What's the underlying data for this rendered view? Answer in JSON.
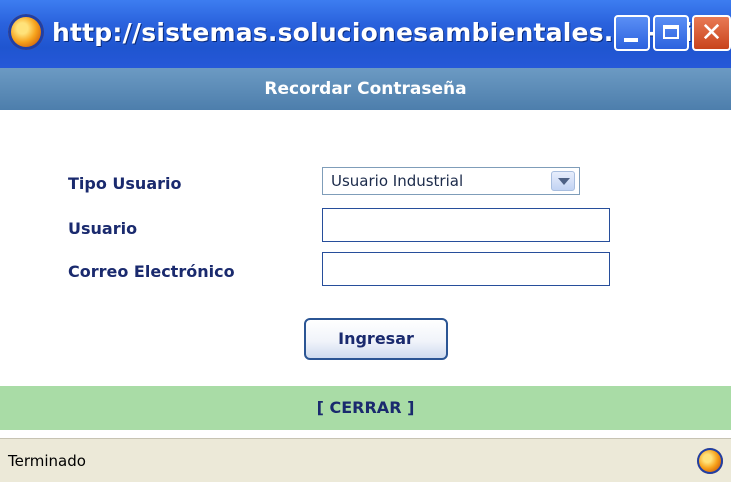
{
  "window": {
    "title": "http://sistemas.solucionesambientales.cl - Sist...",
    "icon": "firefox-icon",
    "buttons": {
      "minimize": "minimize-icon",
      "maximize": "maximize-icon",
      "close": "close-icon",
      "close_glyph": "✕"
    }
  },
  "dialog": {
    "title": "Recordar Contraseña",
    "header_color": "#5a88b6"
  },
  "form": {
    "tipo_label": "Tipo Usuario",
    "tipo_selected": "Usuario Industrial",
    "usuario_label": "Usuario",
    "usuario_value": "",
    "correo_label": "Correo Electrónico",
    "correo_value": "",
    "submit_label": "Ingresar"
  },
  "footer": {
    "close_label": "[ CERRAR ]",
    "color": "#a9dca6"
  },
  "status": {
    "text": "Terminado",
    "icon": "firefox-icon"
  }
}
